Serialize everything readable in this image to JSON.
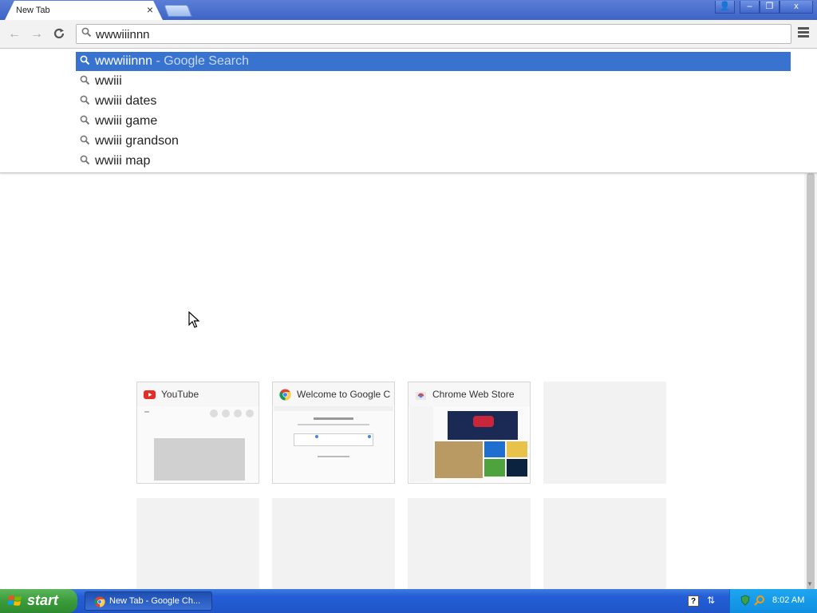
{
  "browser": {
    "tab_title": "New Tab",
    "tab_close": "×",
    "window_buttons": {
      "profile": "👤",
      "minimize": "–",
      "maximize": "❐",
      "close": "x"
    }
  },
  "toolbar": {
    "back_icon": "←",
    "forward_icon": "→",
    "reload_icon": "C",
    "omnibox_value": "wwwiiinnn"
  },
  "suggestions": [
    {
      "text": "wwwiiinnn",
      "hint": " - Google Search",
      "selected": true
    },
    {
      "text": "wwiii",
      "hint": ""
    },
    {
      "text": "wwiii dates",
      "hint": ""
    },
    {
      "text": "wwiii game",
      "hint": ""
    },
    {
      "text": "wwiii grandson",
      "hint": ""
    },
    {
      "text": "wwiii map",
      "hint": ""
    }
  ],
  "most_visited": [
    {
      "title": "YouTube",
      "icon": "youtube-icon"
    },
    {
      "title": "Welcome to Google C",
      "icon": "chrome-icon"
    },
    {
      "title": "Chrome Web Store",
      "icon": "chrome-web-store-icon"
    }
  ],
  "taskbar": {
    "start_label": "start",
    "task_label": "New Tab - Google Ch...",
    "clock": "8:02 AM",
    "help_icon": "?"
  },
  "colors": {
    "selection": "#3874cf",
    "taskbar": "#245ed6",
    "start_button": "#3a9c3a"
  }
}
